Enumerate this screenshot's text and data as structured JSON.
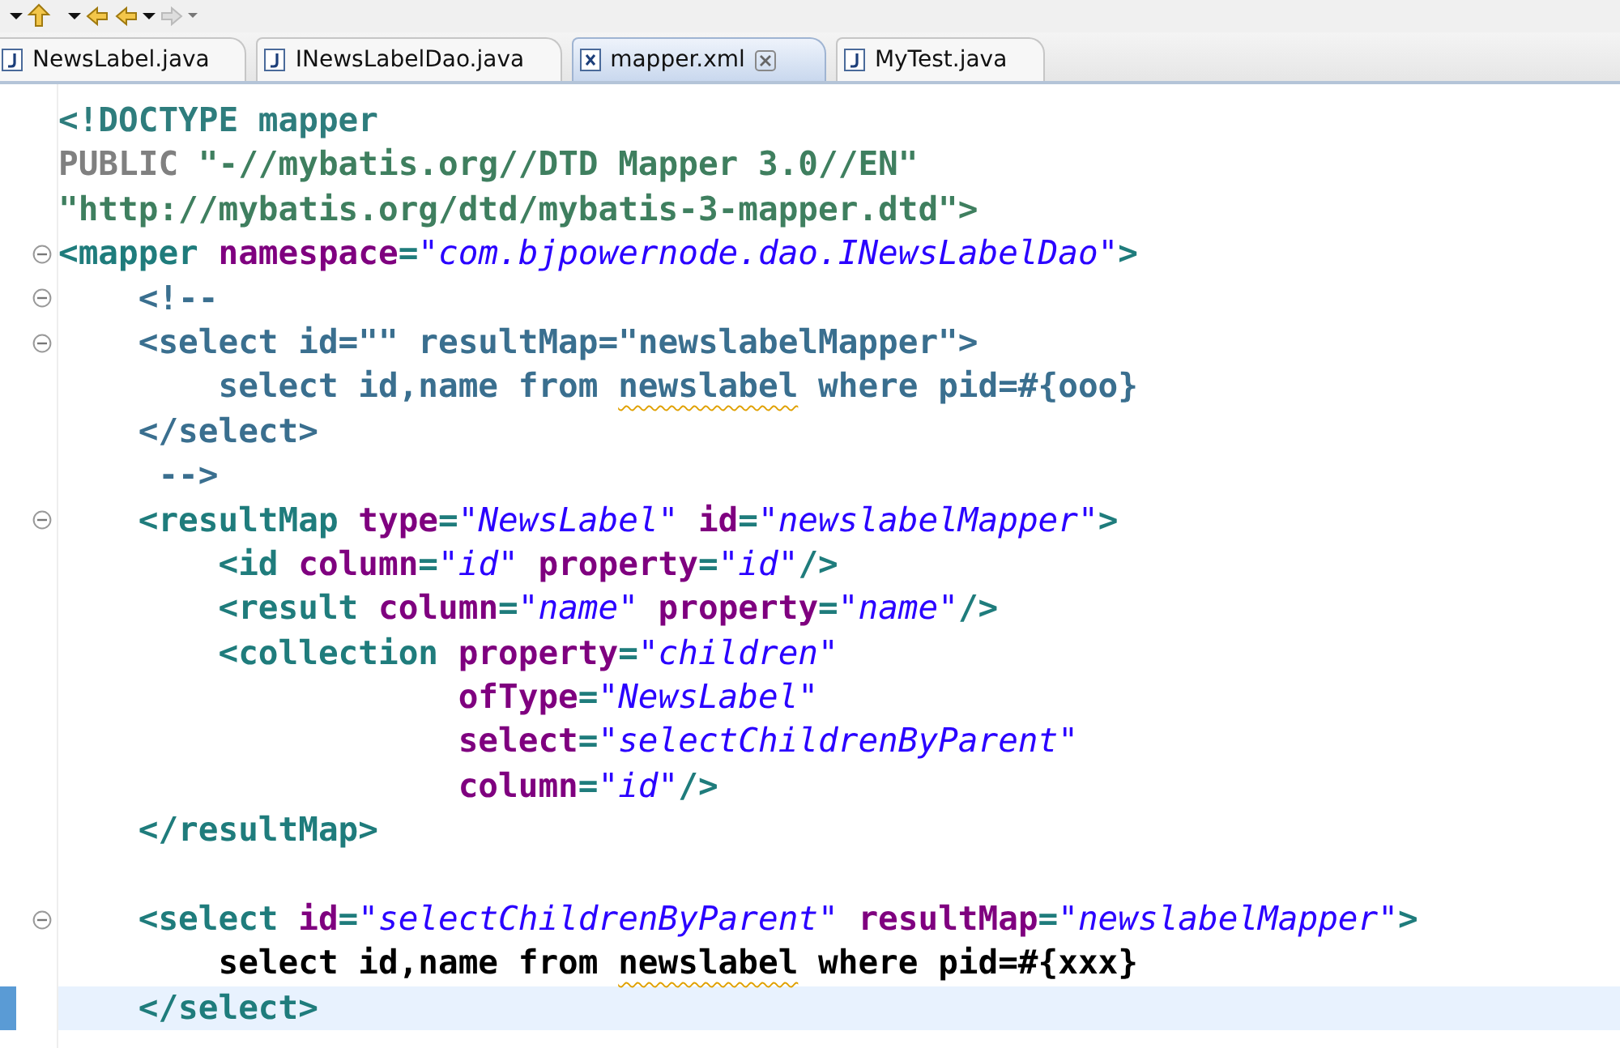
{
  "tabs": [
    {
      "label": "NewsLabel.java",
      "kind": "java",
      "selected": false,
      "closable": false
    },
    {
      "label": "INewsLabelDao.java",
      "kind": "java",
      "selected": false,
      "closable": false
    },
    {
      "label": "mapper.xml",
      "kind": "xml",
      "selected": true,
      "closable": true
    },
    {
      "label": "MyTest.java",
      "kind": "java",
      "selected": false,
      "closable": false
    }
  ],
  "editor": {
    "lines": [
      {
        "fold": false,
        "current": false,
        "tokens": [
          {
            "kind": "decl",
            "text": "<!DOCTYPE mapper"
          }
        ]
      },
      {
        "fold": false,
        "current": false,
        "tokens": [
          {
            "kind": "keyword",
            "text": "PUBLIC "
          },
          {
            "kind": "decl_string",
            "text": "\"-//mybatis.org//DTD Mapper 3.0//EN\""
          }
        ]
      },
      {
        "fold": false,
        "current": false,
        "tokens": [
          {
            "kind": "decl_string",
            "text": "\"http://mybatis.org/dtd/mybatis-3-mapper.dtd\">"
          }
        ]
      },
      {
        "fold": true,
        "current": false,
        "tokens": [
          {
            "kind": "tag",
            "text": "<mapper"
          },
          {
            "kind": "attr",
            "text": " namespace"
          },
          {
            "kind": "tag",
            "text": "="
          },
          {
            "kind": "value",
            "text": "\"com.bjpowernode.dao.INewsLabelDao\""
          },
          {
            "kind": "tag",
            "text": ">"
          }
        ]
      },
      {
        "fold": true,
        "current": false,
        "tokens": [
          {
            "kind": "comment",
            "text": "    <!--"
          }
        ]
      },
      {
        "fold": true,
        "current": false,
        "tokens": [
          {
            "kind": "comment",
            "text": "    <select id=\"\" resultMap=\"newslabelMapper\">"
          }
        ]
      },
      {
        "fold": false,
        "current": false,
        "tokens": [
          {
            "kind": "comment",
            "text": "        select id,name from "
          },
          {
            "kind": "comment_flagged",
            "text": "newslabel"
          },
          {
            "kind": "comment",
            "text": " where pid=#{ooo}"
          }
        ]
      },
      {
        "fold": false,
        "current": false,
        "tokens": [
          {
            "kind": "comment",
            "text": "    </select>"
          }
        ]
      },
      {
        "fold": false,
        "current": false,
        "tokens": [
          {
            "kind": "comment",
            "text": "     -->"
          }
        ]
      },
      {
        "fold": true,
        "current": false,
        "tokens": [
          {
            "kind": "tag",
            "text": "    <resultMap"
          },
          {
            "kind": "attr",
            "text": " type"
          },
          {
            "kind": "tag",
            "text": "="
          },
          {
            "kind": "value",
            "text": "\"NewsLabel\""
          },
          {
            "kind": "attr",
            "text": " id"
          },
          {
            "kind": "tag",
            "text": "="
          },
          {
            "kind": "value",
            "text": "\"newslabelMapper\""
          },
          {
            "kind": "tag",
            "text": ">"
          }
        ]
      },
      {
        "fold": false,
        "current": false,
        "tokens": [
          {
            "kind": "tag",
            "text": "        <id"
          },
          {
            "kind": "attr",
            "text": " column"
          },
          {
            "kind": "tag",
            "text": "="
          },
          {
            "kind": "value",
            "text": "\"id\""
          },
          {
            "kind": "attr",
            "text": " property"
          },
          {
            "kind": "tag",
            "text": "="
          },
          {
            "kind": "value",
            "text": "\"id\""
          },
          {
            "kind": "tag",
            "text": "/>"
          }
        ]
      },
      {
        "fold": false,
        "current": false,
        "tokens": [
          {
            "kind": "tag",
            "text": "        <result"
          },
          {
            "kind": "attr",
            "text": " column"
          },
          {
            "kind": "tag",
            "text": "="
          },
          {
            "kind": "value",
            "text": "\"name\""
          },
          {
            "kind": "attr",
            "text": " property"
          },
          {
            "kind": "tag",
            "text": "="
          },
          {
            "kind": "value",
            "text": "\"name\""
          },
          {
            "kind": "tag",
            "text": "/>"
          }
        ]
      },
      {
        "fold": false,
        "current": false,
        "tokens": [
          {
            "kind": "tag",
            "text": "        <collection"
          },
          {
            "kind": "attr",
            "text": " property"
          },
          {
            "kind": "tag",
            "text": "="
          },
          {
            "kind": "value",
            "text": "\"children\""
          }
        ]
      },
      {
        "fold": false,
        "current": false,
        "tokens": [
          {
            "kind": "attr",
            "text": "                    ofType"
          },
          {
            "kind": "tag",
            "text": "="
          },
          {
            "kind": "value",
            "text": "\"NewsLabel\""
          }
        ]
      },
      {
        "fold": false,
        "current": false,
        "tokens": [
          {
            "kind": "attr",
            "text": "                    select"
          },
          {
            "kind": "tag",
            "text": "="
          },
          {
            "kind": "value",
            "text": "\"selectChildrenByParent\""
          }
        ]
      },
      {
        "fold": false,
        "current": false,
        "tokens": [
          {
            "kind": "attr",
            "text": "                    column"
          },
          {
            "kind": "tag",
            "text": "="
          },
          {
            "kind": "value",
            "text": "\"id\""
          },
          {
            "kind": "tag",
            "text": "/>"
          }
        ]
      },
      {
        "fold": false,
        "current": false,
        "tokens": [
          {
            "kind": "tag",
            "text": "    </resultMap>"
          }
        ]
      },
      {
        "fold": false,
        "current": false
      },
      {
        "fold": true,
        "current": false,
        "tokens": [
          {
            "kind": "tag",
            "text": "    <select"
          },
          {
            "kind": "attr",
            "text": " id"
          },
          {
            "kind": "tag",
            "text": "="
          },
          {
            "kind": "value",
            "text": "\"selectChildrenByParent\""
          },
          {
            "kind": "attr",
            "text": " resultMap"
          },
          {
            "kind": "tag",
            "text": "="
          },
          {
            "kind": "value",
            "text": "\"newslabelMapper\""
          },
          {
            "kind": "tag",
            "text": ">"
          }
        ]
      },
      {
        "fold": false,
        "current": false,
        "tokens": [
          {
            "kind": "text",
            "text": "        select id,name from "
          },
          {
            "kind": "text_flagged",
            "text": "newslabel"
          },
          {
            "kind": "text",
            "text": " where pid=#{xxx}"
          }
        ]
      },
      {
        "fold": false,
        "current": true,
        "tokens": [
          {
            "kind": "tag",
            "text": "    </select>"
          }
        ]
      }
    ]
  }
}
